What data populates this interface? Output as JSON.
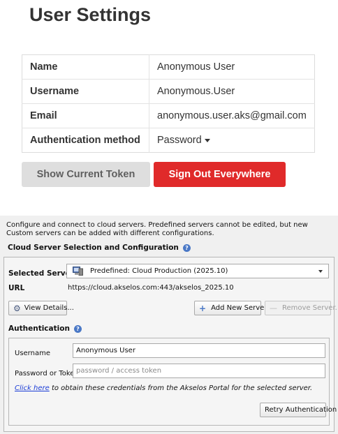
{
  "user_settings": {
    "title": "User Settings",
    "rows": [
      {
        "key": "Name",
        "value": "Anonymous User"
      },
      {
        "key": "Username",
        "value": "Anonymous.User"
      },
      {
        "key": "Email",
        "value": "anonymous.user.aks@gmail.com"
      },
      {
        "key": "Authentication method",
        "value": "Password"
      }
    ],
    "show_token_label": "Show Current Token",
    "sign_out_label": "Sign Out Everywhere",
    "colors": {
      "sign_out": "#e02a2a",
      "show_token": "#dedede"
    }
  },
  "cloud": {
    "description": "Configure and connect to cloud servers. Predefined servers cannot be edited, but new Custom servers can be added with different configurations.",
    "heading": "Cloud Server Selection and Configuration",
    "selected_server_label": "Selected Server",
    "selected_server_value": "Predefined: Cloud Production (2025.10)",
    "server_icon": "server-icon",
    "url_label": "URL",
    "url_value": "https://cloud.akselos.com:443/akselos_2025.10",
    "view_details_label": "View Details...",
    "add_server_label": "Add New Server...",
    "remove_server_label": "Remove Server...",
    "auth": {
      "heading": "Authentication",
      "username_label": "Username",
      "username_value": "Anonymous User",
      "password_label": "Password or Token",
      "password_placeholder": "password / access token",
      "link_text": "Click here",
      "hint_text": " to obtain these credentials from the Akselos Portal for the selected server.",
      "retry_label": "Retry Authentication"
    },
    "colors": {
      "help_icon": "#4a78c6",
      "link": "#1a3cd6"
    }
  }
}
